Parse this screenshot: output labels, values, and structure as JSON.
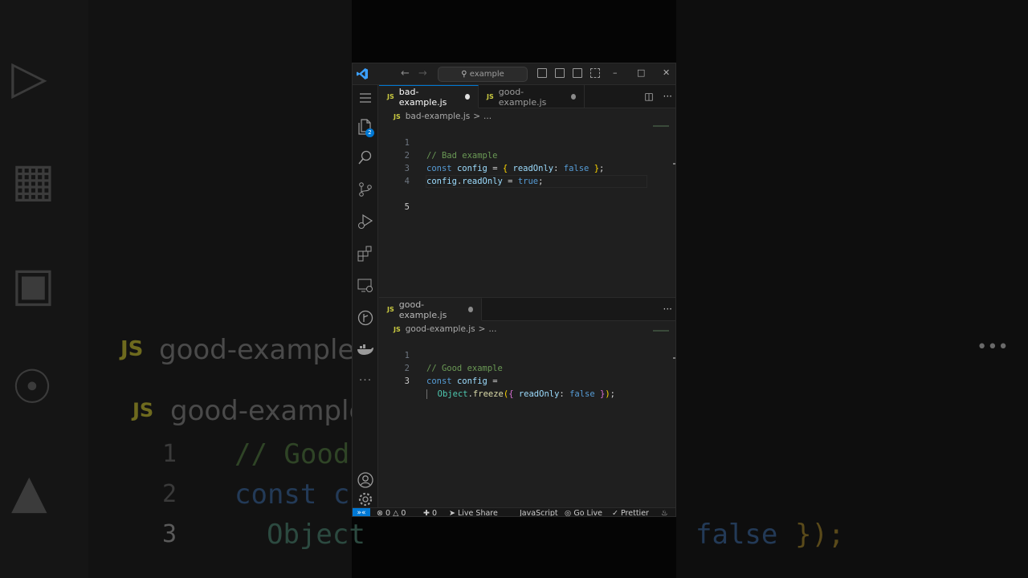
{
  "titlebar": {
    "search_text": "example"
  },
  "activity_bar": {
    "explorer_badge": "2"
  },
  "top_group": {
    "tabs": [
      {
        "badge": "JS",
        "label": "bad-example.js",
        "active": true
      },
      {
        "badge": "JS",
        "label": "good-example.js",
        "active": false
      }
    ],
    "breadcrumb": {
      "badge": "JS",
      "file": "bad-example.js",
      "sep": ">",
      "more": "..."
    },
    "lines": [
      {
        "n": "1",
        "t": "// Bad example"
      },
      {
        "n": "2",
        "t": "const config = { readOnly: false };"
      },
      {
        "n": "3",
        "t": "config.readOnly = true;"
      },
      {
        "n": "4",
        "t": ""
      },
      {
        "n": "5",
        "t": ""
      }
    ]
  },
  "bottom_group": {
    "tabs": [
      {
        "badge": "JS",
        "label": "good-example.js",
        "active": true
      }
    ],
    "breadcrumb": {
      "badge": "JS",
      "file": "good-example.js",
      "sep": ">",
      "more": "..."
    },
    "lines": [
      {
        "n": "1",
        "t": "// Good example"
      },
      {
        "n": "2",
        "t": "const config ="
      },
      {
        "n": "3",
        "t": "  Object.freeze({ readOnly: false });"
      }
    ]
  },
  "statusbar": {
    "errors": "0",
    "warnings": "0",
    "ports": "0",
    "live_share": "Live Share",
    "language": "JavaScript",
    "go_live": "Go Live",
    "prettier": "Prettier"
  },
  "background": {
    "tab_label": "good-example.js",
    "crumb_label": "good-example.js",
    "badge": "JS",
    "line_numbers": [
      "1",
      "2",
      "3"
    ],
    "code_fragments": [
      "// Good",
      "const c",
      "Object",
      "false",
      "});"
    ]
  },
  "colors": {
    "accent": "#0078d4",
    "editor_bg": "#1f1f1f",
    "comment": "#6a9955",
    "keyword": "#569cd6",
    "variable": "#9cdcfe",
    "function": "#dcdcaa",
    "bracket": "#ffd700",
    "js_badge": "#cbcb41"
  }
}
